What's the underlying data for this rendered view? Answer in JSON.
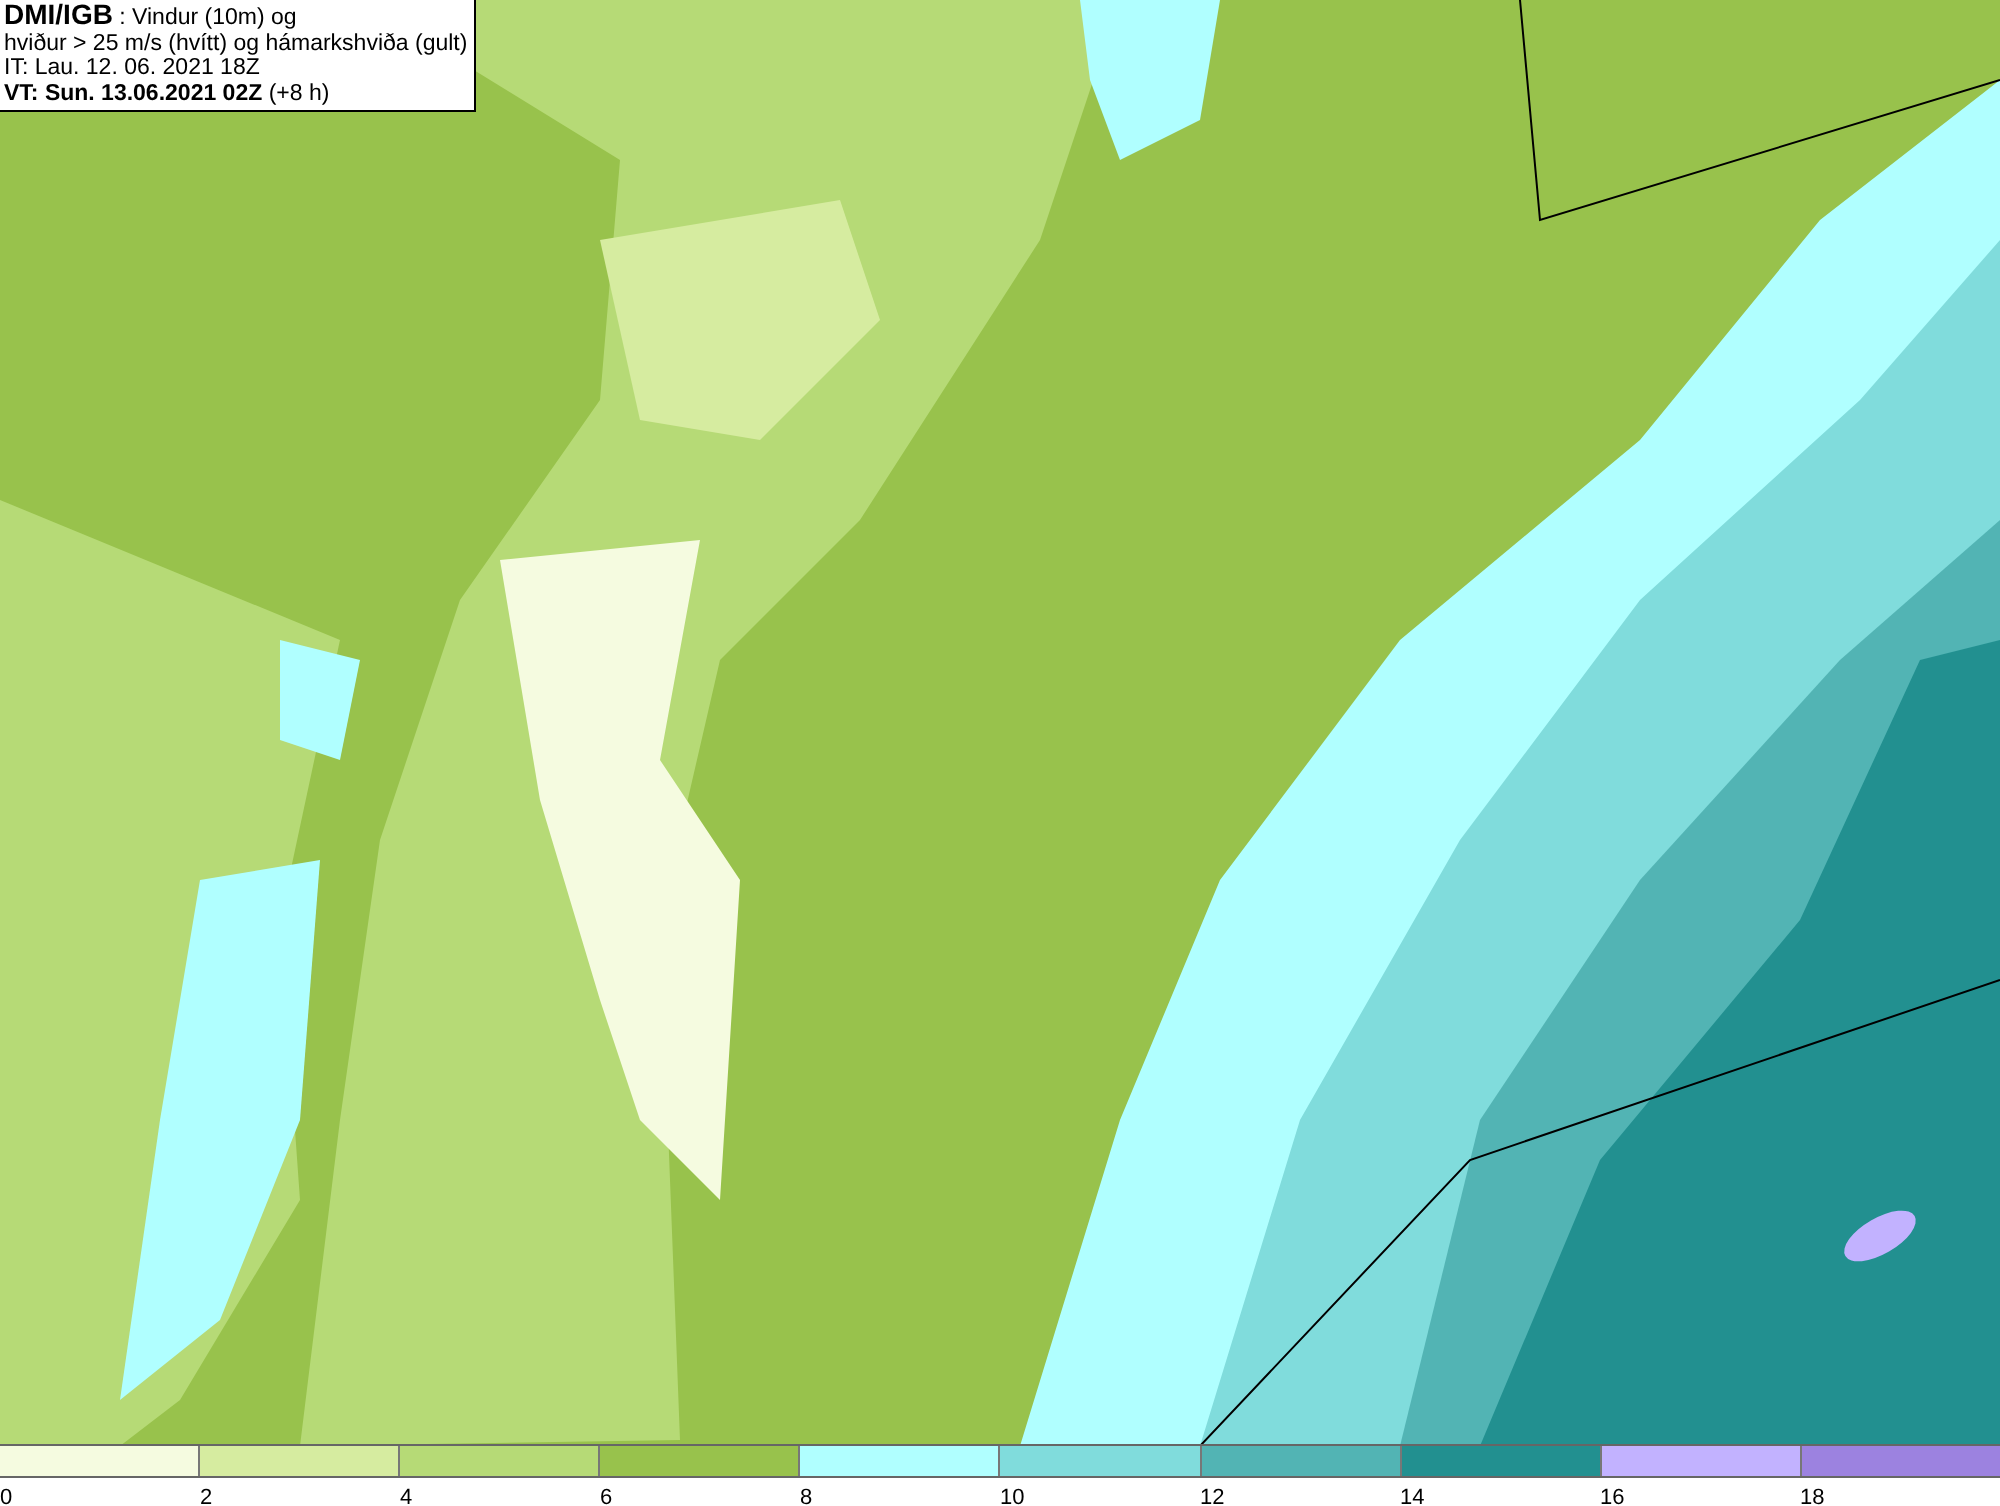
{
  "header": {
    "lines": [
      "**DMI/IGB** : Vindur (10m) og",
      "hviður > 25 m/s (hvítt) og hámarkshviða (gult)",
      "IT: Lau. 12. 06. 2021 18Z",
      "**VT: Sun. 13.06.2021 02Z** (+8 h)"
    ]
  },
  "legend": [
    {
      "label": "0",
      "color": "#f5fbe0"
    },
    {
      "label": "2",
      "color": "#d6eca0"
    },
    {
      "label": "4",
      "color": "#b6da76"
    },
    {
      "label": "6",
      "color": "#98c24c"
    },
    {
      "label": "8",
      "color": "#b0ffff"
    },
    {
      "label": "10",
      "color": "#80dcdc"
    },
    {
      "label": "12",
      "color": "#52b4b4"
    },
    {
      "label": "14",
      "color": "#229090"
    },
    {
      "label": "16",
      "color": "#c2b2ff"
    },
    {
      "label": "18",
      "color": "#9c82e0"
    }
  ]
}
